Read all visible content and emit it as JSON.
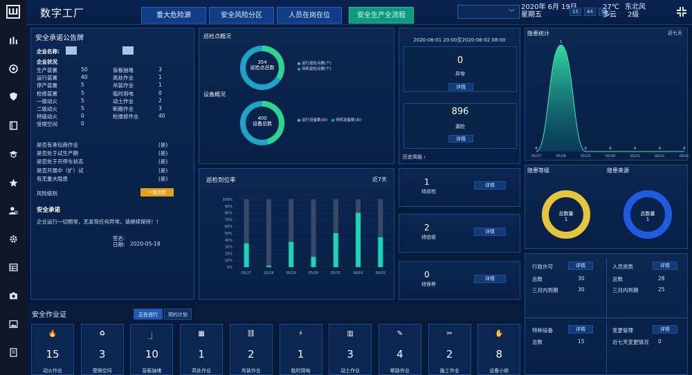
{
  "app": {
    "title": "数字工厂"
  },
  "tabs": [
    {
      "label": "重大危险源"
    },
    {
      "label": "安全风险分区"
    },
    {
      "label": "人员在岗在位"
    },
    {
      "label": "安全生产全流程",
      "active": true
    }
  ],
  "header": {
    "select_chevron": "﹀",
    "date": "2020年 6月 19日",
    "weekday": "星期五",
    "clock": [
      "15",
      "44",
      "35"
    ],
    "temp": "27℃",
    "wind_dir": "东北风",
    "weather": "多云",
    "wind_level": "2级"
  },
  "notice": {
    "title": "安全承诺公告牌",
    "company_label": "企业名称:",
    "status_title": "企业状况",
    "left_items": [
      {
        "label": "生产装置",
        "value": "50"
      },
      {
        "label": "运行装置",
        "value": "40"
      },
      {
        "label": "停产装置",
        "value": "5"
      },
      {
        "label": "检修装置",
        "value": "5"
      },
      {
        "label": "一级动火",
        "value": "5"
      },
      {
        "label": "二级动火",
        "value": "5"
      },
      {
        "label": "特级动火",
        "value": "0"
      },
      {
        "label": "受限空间",
        "value": "0"
      }
    ],
    "right_items": [
      {
        "label": "盲板抽堵",
        "value": "3"
      },
      {
        "label": "高处作业",
        "value": "1"
      },
      {
        "label": "吊装作业",
        "value": "1"
      },
      {
        "label": "临时用电",
        "value": "0"
      },
      {
        "label": "动土作业",
        "value": "2"
      },
      {
        "label": "断路作业",
        "value": "3"
      },
      {
        "label": "检维修作业",
        "value": "40"
      }
    ],
    "checks": [
      {
        "label": "是否有承包商作业",
        "value": "(是)"
      },
      {
        "label": "是否处于试生产期",
        "value": "(是)"
      },
      {
        "label": "是否处于开停车状态",
        "value": "(是)"
      },
      {
        "label": "是否开展中（扩）试",
        "value": "(是)"
      },
      {
        "label": "有无重大隐患",
        "value": "(是)"
      }
    ],
    "risk_label": "风险级别",
    "risk_value": "一般风险",
    "promise_title": "安全承诺",
    "promise_text": "企业运行一切照常，无发现任何异常。请继续保持！！",
    "sign_label": "签名:",
    "date_label": "日期:",
    "date_value": "2020-05-18"
  },
  "patrol": {
    "title": "巡检点概况",
    "total": "354",
    "total_label": "巡检点总数",
    "legend": [
      "运行巡检点数(个)",
      "待机巡检点数(个)"
    ],
    "device_title": "设备概况",
    "device_total": "400",
    "device_total_label": "设备总数",
    "device_legend": [
      "运行设备数(台)",
      "待机设备数(台)"
    ]
  },
  "patrol_chart": {
    "title": "巡检到位率",
    "range": "近7天",
    "chart_data": {
      "type": "bar",
      "categories": [
        "05/27",
        "05/28",
        "05/29",
        "05/30",
        "05/31",
        "06/01",
        "06/02"
      ],
      "values": [
        35,
        2,
        37,
        15,
        50,
        80,
        44
      ],
      "ylim": [
        0,
        100
      ],
      "yticks": [
        "0%",
        "10%",
        "20%",
        "30%",
        "40%",
        "50%",
        "60%",
        "70%",
        "80%",
        "90%",
        "100%"
      ]
    }
  },
  "stats": {
    "period": "2020-06-01 20:00至2020-06-02 08:00",
    "abnormal_value": "0",
    "abnormal_label": "异常",
    "miss_value": "896",
    "miss_label": "漏检",
    "detail": "详情",
    "history": "历史简报",
    "history_arrow": "›"
  },
  "tasks": [
    {
      "value": "1",
      "label": "待巡检",
      "detail": "详情"
    },
    {
      "value": "2",
      "label": "待验收",
      "detail": "详情"
    },
    {
      "value": "0",
      "label": "待保养",
      "detail": "详情"
    }
  ],
  "hazard": {
    "title": "隐患统计",
    "range": "近七天",
    "chart_data": {
      "type": "area",
      "categories": [
        "05/27",
        "05/28",
        "05/29",
        "05/30",
        "05/31",
        "06/01",
        "06/02"
      ],
      "values": [
        0,
        1,
        0,
        0,
        0,
        0,
        0
      ],
      "ylim": [
        0,
        1
      ]
    }
  },
  "hazard_level": {
    "title_left": "隐患等级",
    "title_right": "隐患来源",
    "left_label": "总数量",
    "left_value": "1",
    "right_label": "总数量",
    "right_value": "1",
    "left_color": "#e5c539",
    "right_color": "#1f5be0"
  },
  "license": {
    "left_title": "行政许可",
    "left_rows": [
      {
        "label": "总数",
        "value": "30"
      },
      {
        "label": "三月内到期",
        "value": "30"
      }
    ],
    "right_title": "人员资质",
    "right_rows": [
      {
        "label": "总数",
        "value": "28"
      },
      {
        "label": "三月内到期",
        "value": "25"
      }
    ],
    "special_title": "特种设备",
    "special_rows": [
      {
        "label": "总数",
        "value": "15"
      }
    ],
    "change_title": "变更管理",
    "change_rows": [
      {
        "label": "近七天变更情况",
        "value": "0"
      }
    ],
    "detail": "详情"
  },
  "cert": {
    "title": "安全作业证",
    "tab_running": "正在进行",
    "tab_plan": "预约计划",
    "items": [
      {
        "icon": "🔥",
        "value": "15",
        "label": "动火作业"
      },
      {
        "icon": "♻",
        "value": "3",
        "label": "受限空间"
      },
      {
        "icon": "⏌",
        "value": "10",
        "label": "盲板抽堵"
      },
      {
        "icon": "▦",
        "value": "1",
        "label": "高处作业"
      },
      {
        "icon": "⛓",
        "value": "2",
        "label": "吊装作业"
      },
      {
        "icon": "⚡",
        "value": "1",
        "label": "临时用电"
      },
      {
        "icon": "▥",
        "value": "3",
        "label": "动土作业"
      },
      {
        "icon": "✎",
        "value": "4",
        "label": "断路作业"
      },
      {
        "icon": "✂",
        "value": "2",
        "label": "施工作业"
      },
      {
        "icon": "✋",
        "value": "8",
        "label": "设备小修"
      }
    ]
  }
}
